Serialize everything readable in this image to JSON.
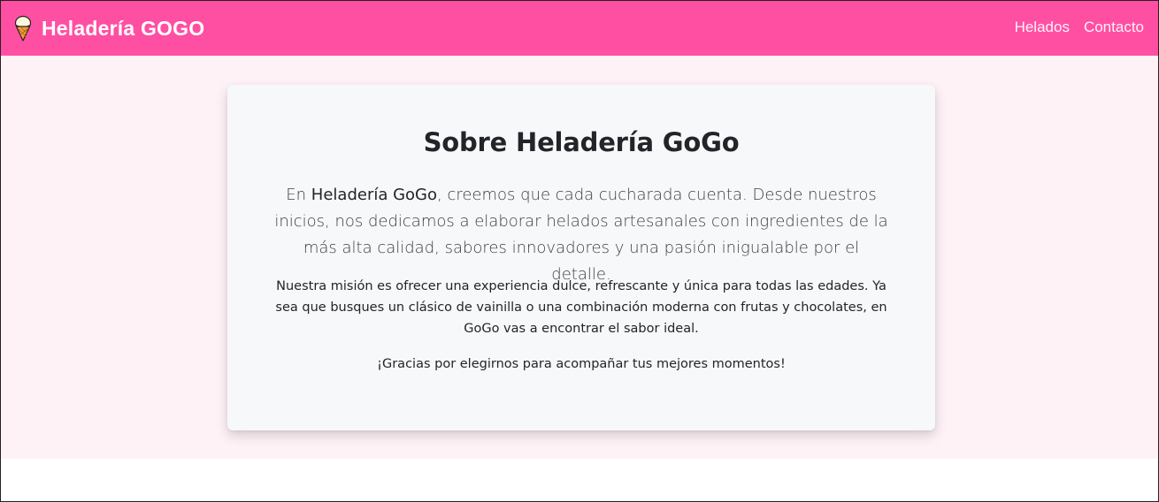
{
  "navbar": {
    "brand_icon": "ice-cream-cone-icon",
    "brand_text": "Heladería GOGO",
    "links": [
      {
        "label": "Helados"
      },
      {
        "label": "Contacto"
      }
    ],
    "background_color": "#ff4fa3"
  },
  "about": {
    "title": "Sobre Heladería GoGo",
    "lead_prefix": "En ",
    "lead_brand": "Heladería GoGo",
    "lead_rest": ", creemos que cada cucharada cuenta. Desde nuestros inicios, nos dedicamos a elaborar helados artesanales con ingredientes de la más alta calidad, sabores innovadores y una pasión inigualable por el detalle.",
    "mission": "Nuestra misión es ofrecer una experiencia dulce, refrescante y única para todas las edades. Ya sea que busques un clásico de vainilla o una combinación moderna con frutas y chocolates, en GoGo vas a encontrar el sabor ideal.",
    "thanks": "¡Gracias por elegirnos para acompañar tus mejores momentos!"
  },
  "colors": {
    "hero_background": "#fff2f7",
    "card_background": "#f7f8fa"
  }
}
